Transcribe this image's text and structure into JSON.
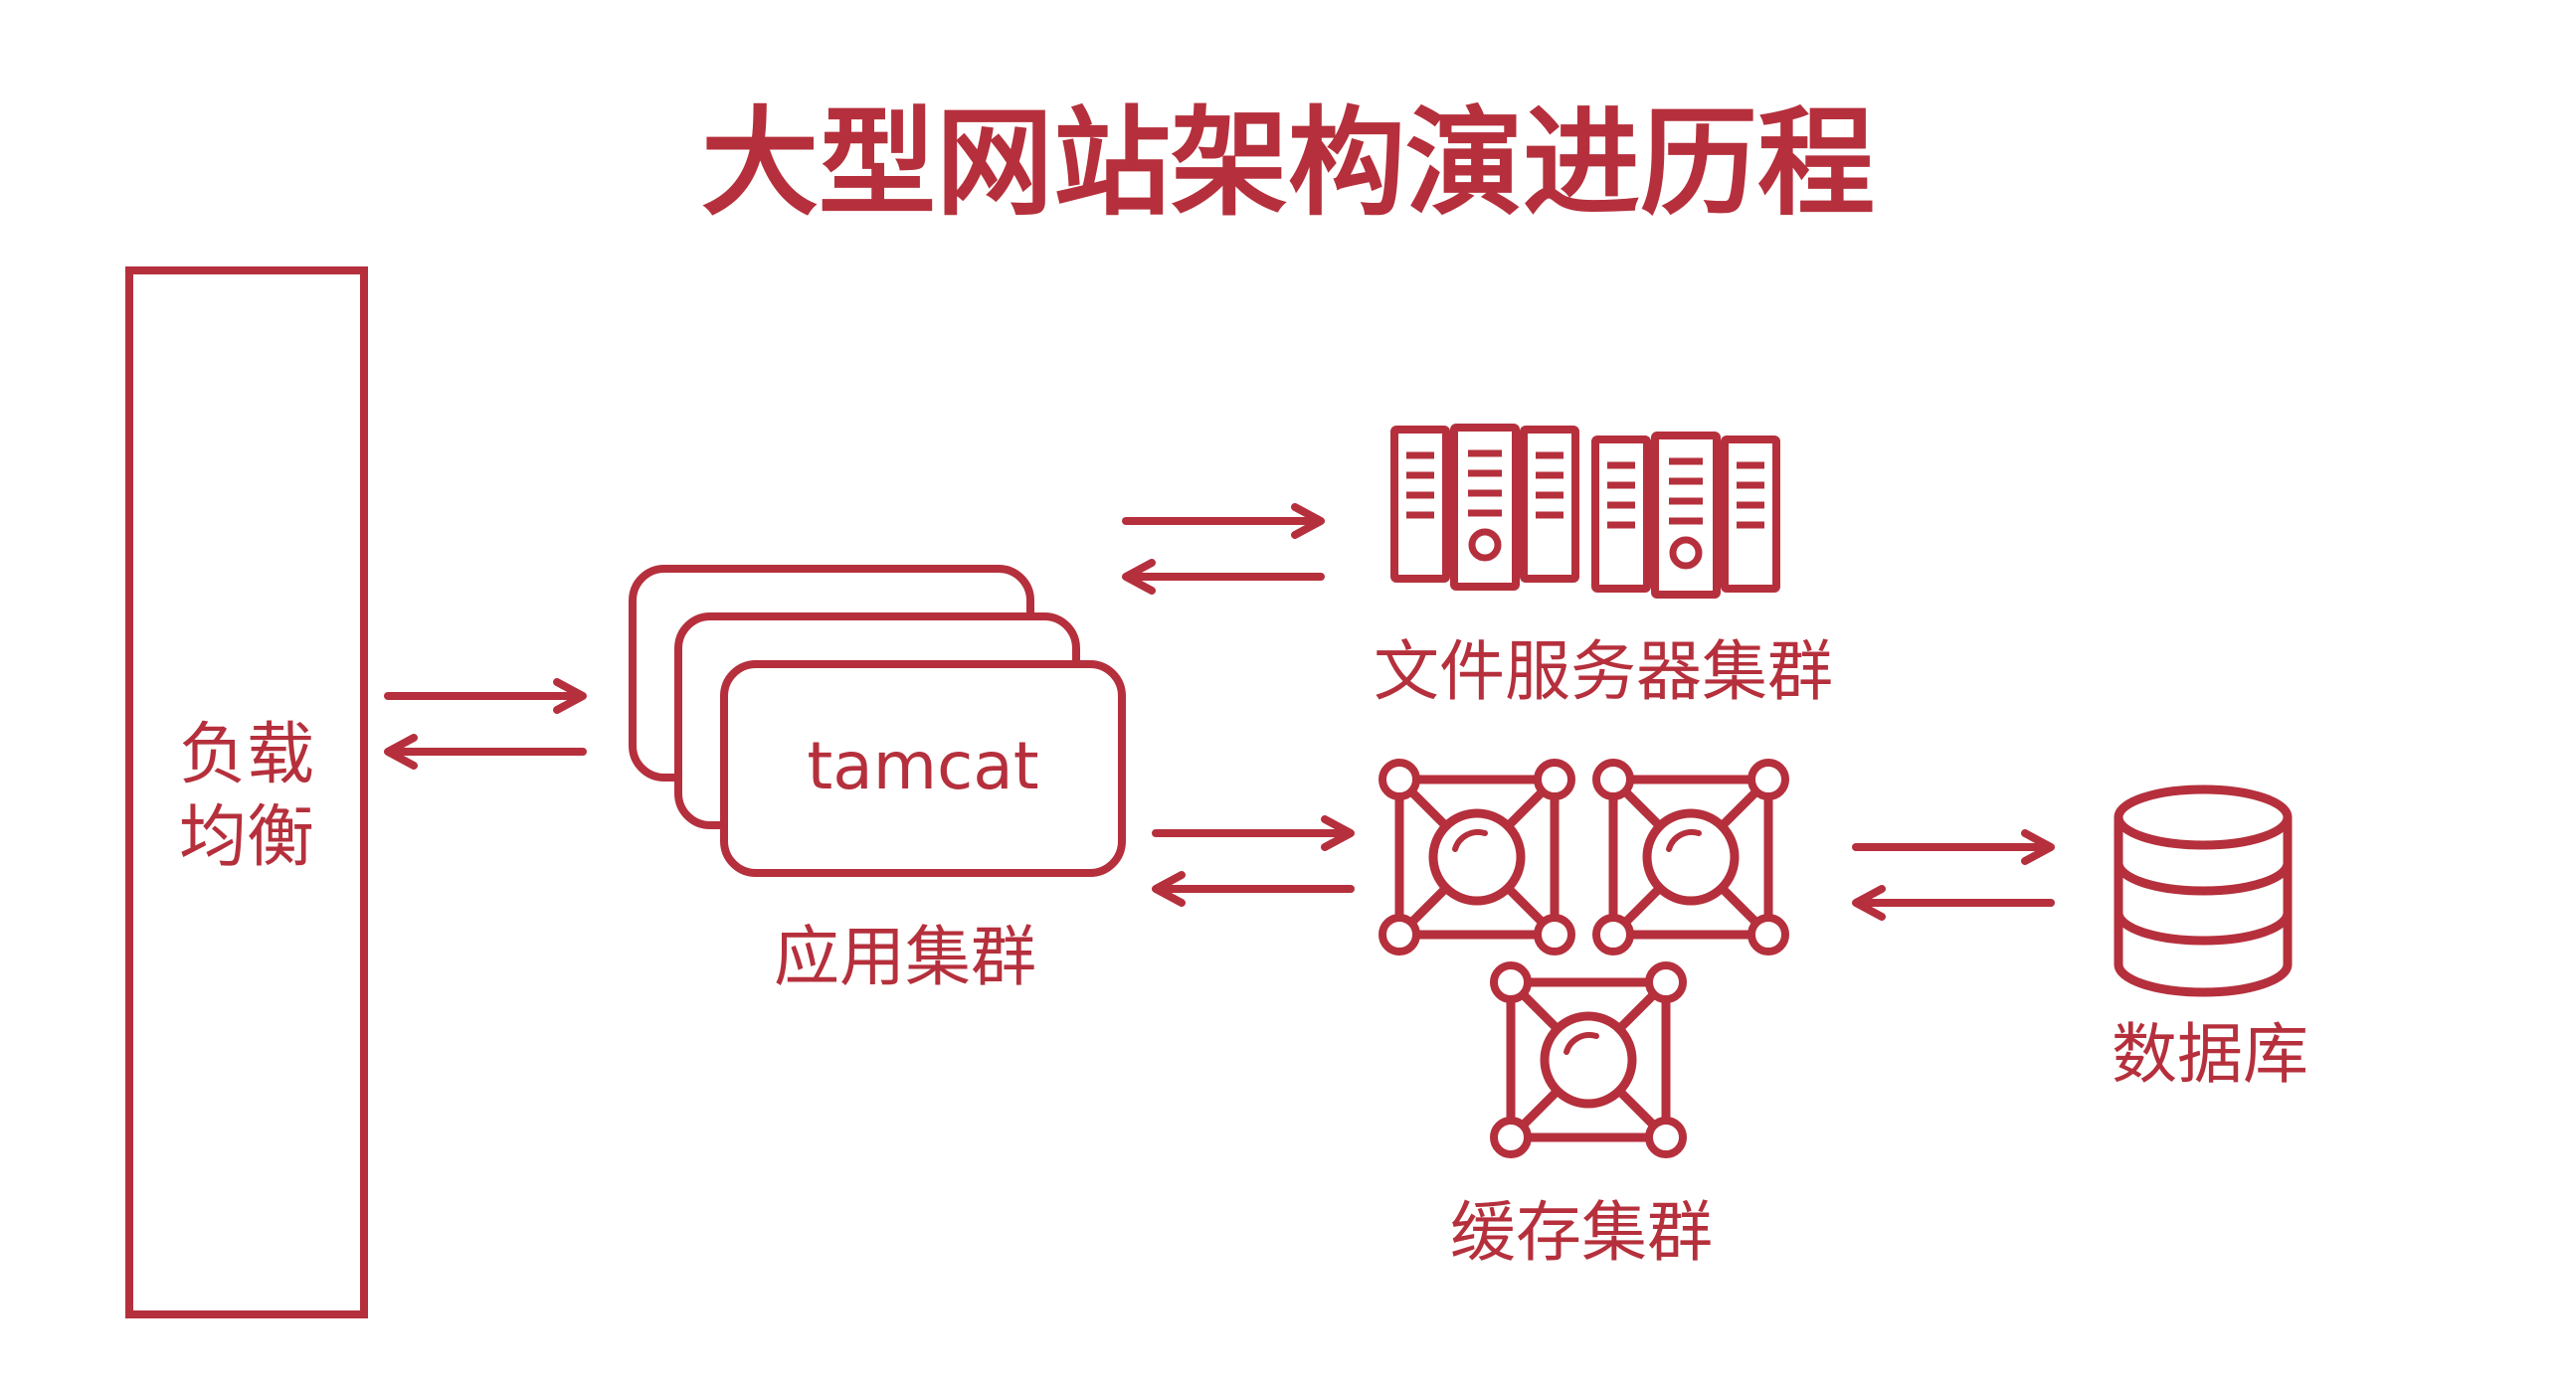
{
  "title": "大型网站架构演进历程",
  "colors": {
    "accent": "#b5303c",
    "background": "#ffffff"
  },
  "load_balancer": {
    "label_line1": "负载",
    "label_line2": "均衡"
  },
  "app_cluster": {
    "card_text": "tamcat",
    "label": "应用集群"
  },
  "file_servers": {
    "label": "文件服务器集群",
    "icon": "server-rack-icon"
  },
  "cache_cluster": {
    "label": "缓存集群",
    "icon": "cache-node-icon"
  },
  "database": {
    "label": "数据库",
    "icon": "database-cylinder-icon"
  }
}
